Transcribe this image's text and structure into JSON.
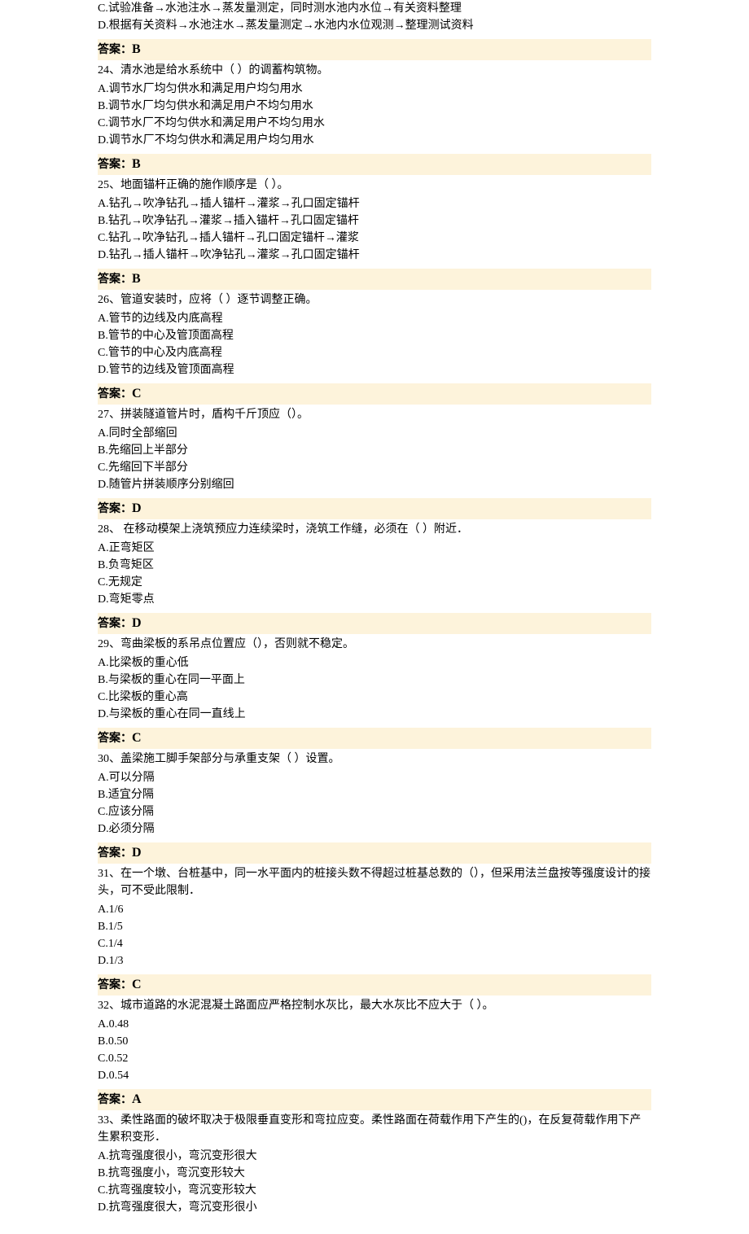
{
  "preOptions": [
    "C.试验准备→水池注水→蒸发量测定，同时测水池内水位→有关资料整理",
    "D.根据有关资料→水池注水→蒸发量测定→水池内水位观测→整理测试资料"
  ],
  "answerLabel": "答案：",
  "preAnswer": "B",
  "questions": [
    {
      "q": "24、清水池是给水系统中（  ）的调蓄构筑物。",
      "opts": [
        "A.调节水厂均匀供水和满足用户均匀用水",
        "B.调节水厂均匀供水和满足用户不均匀用水",
        "C.调节水厂不均匀供水和满足用户不均匀用水",
        "D.调节水厂不均匀供水和满足用户均匀用水"
      ],
      "ans": "B"
    },
    {
      "q": "25、地面锚杆正确的施作顺序是（  ）。",
      "opts": [
        "A.钻孔→吹净钻孔→插人锚杆→灌浆→孔口固定锚杆",
        "B.钻孔→吹净钻孔→灌浆→插入锚杆→孔口固定锚杆",
        "C.钻孔→吹净钻孔→插人锚杆→孔口固定锚杆→灌浆",
        "D.钻孔→插人锚杆→吹净钻孔→灌浆→孔口固定锚杆"
      ],
      "ans": "B"
    },
    {
      "q": "26、管道安装时，应将（  ）逐节调整正确。",
      "opts": [
        "A.管节的边线及内底高程",
        "B.管节的中心及管顶面高程",
        "C.管节的中心及内底高程",
        "D.管节的边线及管顶面高程"
      ],
      "ans": "C"
    },
    {
      "q": "27、拼装隧道管片时，盾构千斤顶应（）。",
      "opts": [
        "A.同时全部缩回",
        "B.先缩回上半部分",
        "C.先缩回下半部分",
        "D.随管片拼装顺序分别缩回"
      ],
      "ans": "D"
    },
    {
      "q": "28、 在移动模架上浇筑预应力连续梁时，浇筑工作缝，必须在（  ）附近．",
      "opts": [
        "A.正弯矩区",
        "B.负弯矩区",
        "C.无规定",
        "D.弯矩零点"
      ],
      "ans": "D"
    },
    {
      "q": "29、弯曲梁板的系吊点位置应（），否则就不稳定。",
      "opts": [
        "A.比梁板的重心低",
        "B.与梁板的重心在同一平面上",
        "C.比梁板的重心高",
        "D.与梁板的重心在同一直线上"
      ],
      "ans": "C"
    },
    {
      "q": "30、盖梁施工脚手架部分与承重支架（  ）设置。",
      "opts": [
        "A.可以分隔",
        "B.适宜分隔",
        "C.应该分隔",
        "D.必须分隔"
      ],
      "ans": "D"
    },
    {
      "q": "31、在一个墩、台桩基中，同一水平面内的桩接头数不得超过桩基总数的（），但采用法兰盘按等强度设计的接头，可不受此限制．",
      "opts": [
        "A.1/6",
        "B.1/5",
        "C.1/4",
        "D.1/3"
      ],
      "ans": "C"
    },
    {
      "q": "32、城市道路的水泥混凝土路面应严格控制水灰比，最大水灰比不应大于（  ）。",
      "opts": [
        "A.0.48",
        "B.0.50",
        "C.0.52",
        "D.0.54"
      ],
      "ans": "A"
    },
    {
      "q": "33、柔性路面的破坏取决于极限垂直变形和弯拉应变。柔性路面在荷载作用下产生的()，在反复荷载作用下产生累积变形．",
      "opts": [
        "A.抗弯强度很小，弯沉变形很大",
        "B.抗弯强度小，弯沉变形较大",
        "C.抗弯强度较小，弯沉变形较大",
        "D.抗弯强度很大，弯沉变形很小"
      ],
      "ans": null
    }
  ]
}
